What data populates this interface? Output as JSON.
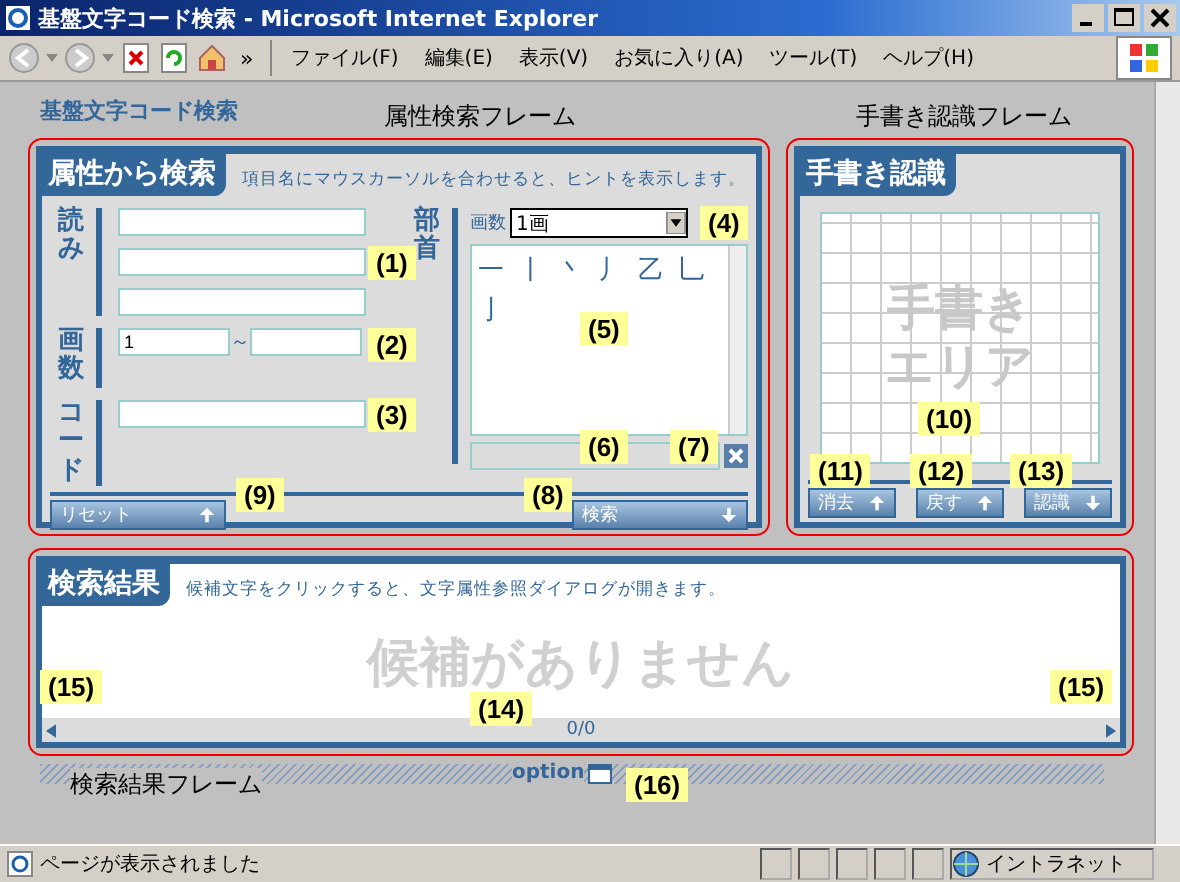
{
  "window": {
    "title": "基盤文字コード検索 - Microsoft Internet Explorer"
  },
  "toolbar": {
    "more": "»",
    "menus": [
      "ファイル(F)",
      "編集(E)",
      "表示(V)",
      "お気に入り(A)",
      "ツール(T)",
      "ヘルプ(H)"
    ]
  },
  "page": {
    "heading": "基盤文字コード検索",
    "frame_labels": [
      "属性検索フレーム",
      "手書き認識フレーム",
      "検索結果フレーム"
    ]
  },
  "attribute_search": {
    "title": "属性から検索",
    "hint": "項目名にマウスカーソルを合わせると、ヒントを表示します。",
    "reading": {
      "label": "読み"
    },
    "strokes": {
      "label": "画数",
      "value": "1",
      "separator": "～"
    },
    "code": {
      "label": "コード"
    },
    "radical": {
      "label": "部首",
      "stroke_label": "画数",
      "stroke_value": "1画",
      "items": [
        "一",
        "丨",
        "丶",
        "丿",
        "乙",
        "乚",
        "亅"
      ]
    },
    "buttons": [
      "リセット",
      "検索"
    ]
  },
  "handwriting": {
    "title": "手書き認識",
    "area_lines": [
      "手書き",
      "エリア"
    ],
    "buttons": [
      "消去",
      "戻す",
      "認識"
    ]
  },
  "results": {
    "title": "検索結果",
    "hint": "候補文字をクリックすると、文字属性参照ダイアログが開きます。",
    "empty": "候補がありません",
    "count": "0/0"
  },
  "option": "option",
  "callouts": [
    {
      "label": "(1)"
    },
    {
      "label": "(2)"
    },
    {
      "label": "(3)"
    },
    {
      "label": "(4)"
    },
    {
      "label": "(5)"
    },
    {
      "label": "(6)"
    },
    {
      "label": "(7)"
    },
    {
      "label": "(8)"
    },
    {
      "label": "(9)"
    },
    {
      "label": "(10)"
    },
    {
      "label": "(11)"
    },
    {
      "label": "(12)"
    },
    {
      "label": "(13)"
    },
    {
      "label": "(14)"
    },
    {
      "label": "(15)"
    },
    {
      "label": "(15)"
    },
    {
      "label": "(16)"
    }
  ],
  "status_bar": {
    "text": "ページが表示されました",
    "zone": "イントラネット"
  }
}
